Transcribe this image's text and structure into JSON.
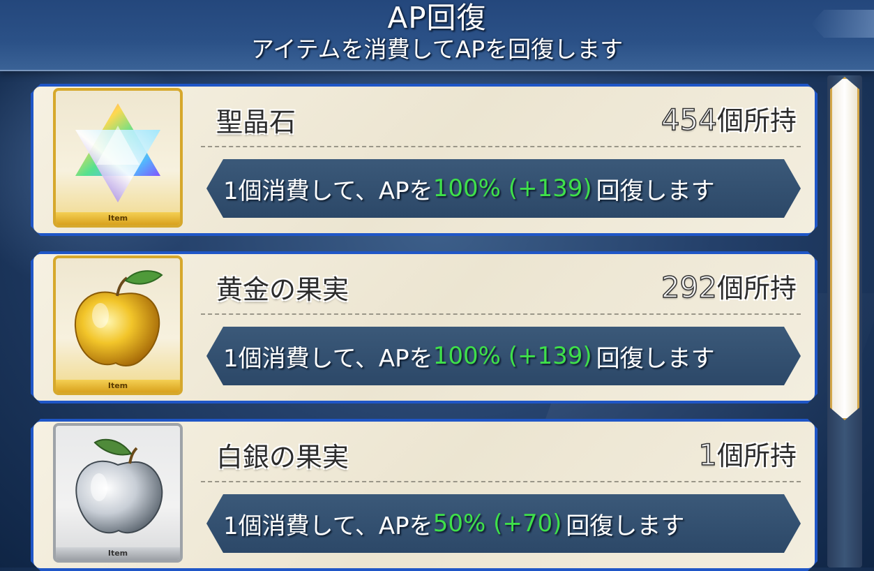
{
  "header": {
    "title": "AP回復",
    "subtitle": "アイテムを消費してAPを回復します"
  },
  "items": [
    {
      "name": "聖晶石",
      "count": "454",
      "count_suffix": "個所持",
      "tag": "Item",
      "icon": "saint-quartz-icon",
      "desc_prefix": "1個消費して、APを",
      "desc_value": "100% (+139)",
      "desc_suffix": "回復します"
    },
    {
      "name": "黄金の果実",
      "count": "292",
      "count_suffix": "個所持",
      "tag": "Item",
      "icon": "golden-apple-icon",
      "desc_prefix": "1個消費して、APを",
      "desc_value": "100% (+139)",
      "desc_suffix": "回復します"
    },
    {
      "name": "白銀の果実",
      "count": "1",
      "count_suffix": "個所持",
      "tag": "Item",
      "icon": "silver-apple-icon",
      "desc_prefix": "1個消費して、APを",
      "desc_value": "50% (+70)",
      "desc_suffix": "回復します"
    }
  ],
  "colors": {
    "card_border": "#1f56c7",
    "highlight_green": "#3fe04a",
    "gold_frame": "#d6a82c",
    "silver_frame": "#9ea3a8"
  }
}
